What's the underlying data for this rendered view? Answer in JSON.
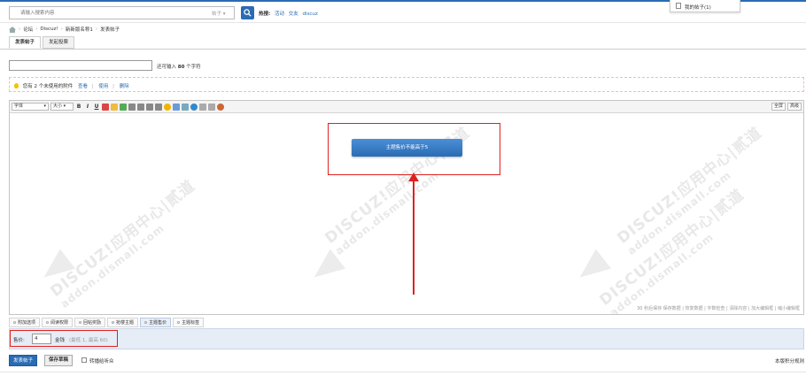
{
  "search": {
    "placeholder": "请输入搜索内容",
    "type_label": "帖子",
    "hot_label": "热搜:",
    "hot_words": [
      "活动",
      "交友",
      "discuz"
    ]
  },
  "popup": {
    "my_posts": "我的帖子(1)"
  },
  "breadcrumb": [
    "论坛",
    "Discuz!",
    "新新版名称1",
    "发表帖子"
  ],
  "tabs": [
    "发表帖子",
    "发起投票"
  ],
  "subject": {
    "hint_prefix": "还可输入",
    "remaining": "80",
    "hint_suffix": "个字符"
  },
  "attachments": {
    "notice": "您有 2 个未使用的附件",
    "links": [
      "查看",
      "使用",
      "删除"
    ]
  },
  "toolbar": {
    "font_select": "字体",
    "size_select": "大小",
    "bold": "B",
    "italic": "I",
    "underline": "U",
    "right_buttons": [
      "全屏",
      "高级"
    ]
  },
  "editor": {
    "price_notice_button": "主题售价不能高于5",
    "status_text": "30 秒后保存 保存数据 | 恢复数据 | 字数检查 | 清除内容 | 加大编辑框 | 缩小编辑框",
    "watermark_top": "DISCUZ!应用中心|贰道",
    "watermark_bottom": "addon.dismall.com"
  },
  "extra_tabs": [
    "附加选项",
    "阅读权限",
    "回帖奖励",
    "抢楼主题",
    "主题售价",
    "主题标签"
  ],
  "price": {
    "label": "售价:",
    "value": "4",
    "unit": "金钱",
    "note": "(最低 1, 最高 60)"
  },
  "bottom": {
    "submit": "发表帖子",
    "draft": "保存草稿",
    "follow_label": "转播给听众",
    "credit_rule": "本版积分规则"
  },
  "colors": {
    "accent": "#2a6cb3",
    "highlight": "#e02020"
  }
}
